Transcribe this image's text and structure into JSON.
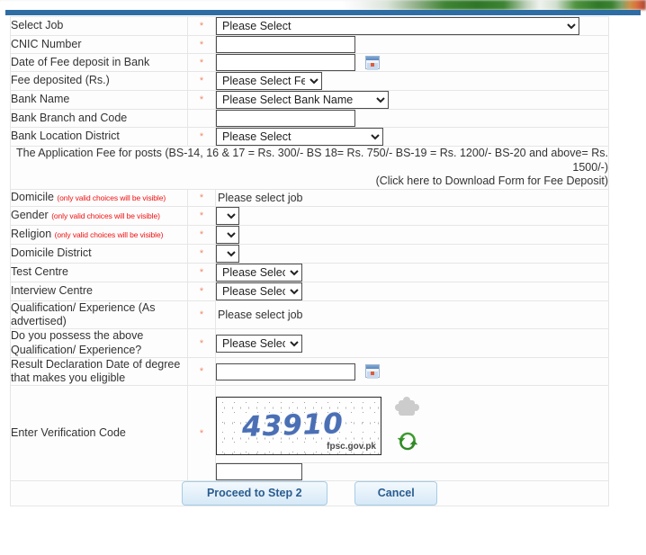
{
  "banner": {
    "accent_bar_color": "#2e6da4",
    "logo_strip": "fpsc-banner-image"
  },
  "form": {
    "required_marker": "*",
    "rows": [
      {
        "label": "Select Job",
        "required": true,
        "control": "select",
        "value": "Please Select"
      },
      {
        "label": "CNIC Number",
        "required": true,
        "control": "text",
        "value": ""
      },
      {
        "label": "Date of Fee deposit in Bank",
        "required": true,
        "control": "date",
        "value": ""
      },
      {
        "label": "Fee deposited (Rs.)",
        "required": true,
        "control": "select",
        "value": "Please Select Fee"
      },
      {
        "label": "Bank Name",
        "required": true,
        "control": "select",
        "value": "Please Select Bank Name"
      },
      {
        "label": "Bank Branch and Code",
        "required": false,
        "control": "text",
        "value": ""
      },
      {
        "label": "Bank Location District",
        "required": true,
        "control": "select",
        "value": "Please Select"
      }
    ],
    "fee_info": {
      "line1": "The Application Fee for posts (BS-14, 16 & 17 = Rs. 300/- BS 18= Rs. 750/- BS-19 = Rs. 1200/- BS-20 and above= Rs. 1500/-)",
      "line2": "(Click here to Download Form for Fee Deposit)"
    },
    "rows2": [
      {
        "label": "Domicile",
        "sublabel": "(only valid choices will be visible)",
        "required": true,
        "control": "static",
        "value": "Please select job"
      },
      {
        "label": "Gender",
        "sublabel": "(only valid choices will be visible)",
        "required": true,
        "control": "select-tiny",
        "value": ""
      },
      {
        "label": "Religion",
        "sublabel": "(only valid choices will be visible)",
        "required": true,
        "control": "select-tiny",
        "value": ""
      },
      {
        "label": "Domicile District",
        "sublabel": "",
        "required": true,
        "control": "select-tiny",
        "value": ""
      },
      {
        "label": "Test Centre",
        "sublabel": "",
        "required": true,
        "control": "select-sm",
        "value": "Please Select"
      },
      {
        "label": "Interview Centre",
        "sublabel": "",
        "required": true,
        "control": "select-sm",
        "value": "Please Select"
      },
      {
        "label": "Qualification/ Experience (As advertised)",
        "sublabel": "",
        "required": true,
        "control": "static",
        "value": "Please select job"
      },
      {
        "label": "Do you possess the above Qualification/ Experience?",
        "sublabel": "",
        "required": true,
        "control": "select-sm",
        "value": "Please Select"
      },
      {
        "label": "Result Declaration Date of degree that makes you eligible",
        "sublabel": "",
        "required": true,
        "control": "date",
        "value": ""
      }
    ],
    "captcha": {
      "label": "Enter Verification Code",
      "required": true,
      "code_text": "43910",
      "watermark": "fpsc.gov.pk",
      "code_color": "#4a6fb5",
      "input_value": "",
      "refresh_icon": "refresh-icon",
      "puzzle_icon": "puzzle-icon"
    },
    "buttons": {
      "proceed": "Proceed to Step 2",
      "cancel": "Cancel",
      "accent_color": "#2a5c8f"
    }
  }
}
